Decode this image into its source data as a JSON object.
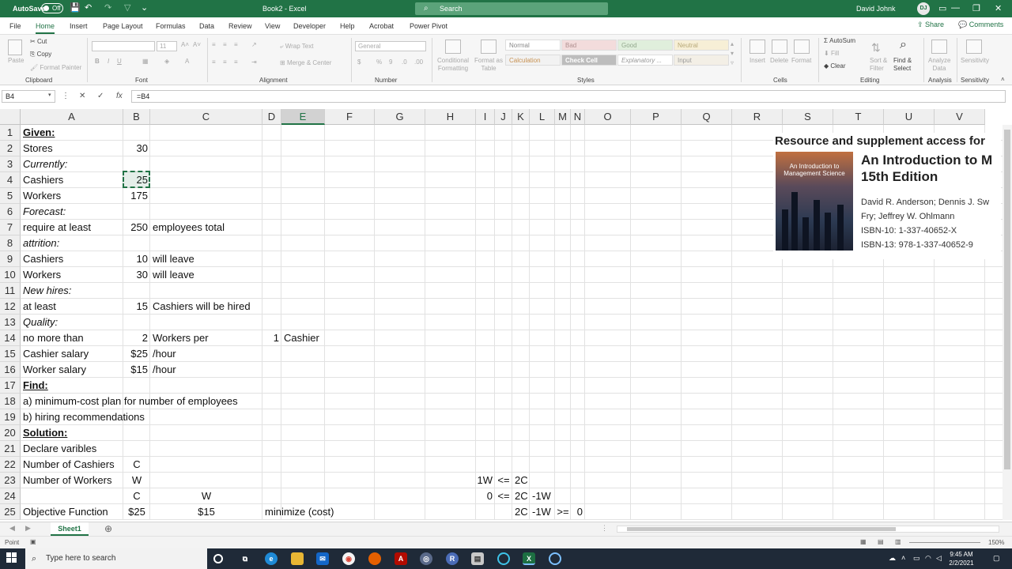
{
  "titlebar": {
    "autosave_label": "AutoSave",
    "autosave_state": "Off",
    "document_title": "Book2 - Excel",
    "search_placeholder": "Search",
    "user_name": "David Johnk",
    "user_initials": "DJ"
  },
  "ribbon_tabs": [
    "File",
    "Home",
    "Insert",
    "Page Layout",
    "Formulas",
    "Data",
    "Review",
    "View",
    "Developer",
    "Help",
    "Acrobat",
    "Power Pivot"
  ],
  "active_tab": "Home",
  "share_label": "Share",
  "comments_label": "Comments",
  "ribbon": {
    "clipboard": {
      "cut": "Cut",
      "copy": "Copy",
      "format_painter": "Format Painter",
      "paste": "Paste",
      "label": "Clipboard"
    },
    "font": {
      "label": "Font",
      "size": "11"
    },
    "alignment": {
      "wrap_text": "Wrap Text",
      "merge_center": "Merge & Center",
      "label": "Alignment"
    },
    "number": {
      "format": "General",
      "label": "Number"
    },
    "styles": {
      "conditional_formatting": "Conditional Formatting",
      "format_as_table": "Format as Table",
      "cells": [
        "Normal",
        "Bad",
        "Good",
        "Neutral",
        "Calculation",
        "Check Cell",
        "Explanatory ...",
        "Input"
      ],
      "label": "Styles"
    },
    "cells": {
      "insert": "Insert",
      "delete": "Delete",
      "format": "Format",
      "label": "Cells"
    },
    "editing": {
      "autosum": "AutoSum",
      "fill": "Fill",
      "clear": "Clear",
      "sort_filter": "Sort & Filter",
      "find_select": "Find & Select",
      "label": "Editing"
    },
    "analysis": {
      "analyze_data": "Analyze Data",
      "label": "Analysis"
    },
    "sensitivity": {
      "label": "Sensitivity"
    }
  },
  "formula_bar": {
    "name_box": "B4",
    "formula": "=B4"
  },
  "columns": [
    "A",
    "B",
    "C",
    "D",
    "E",
    "F",
    "G",
    "H",
    "I",
    "J",
    "K",
    "L",
    "M",
    "N",
    "O",
    "P",
    "Q",
    "R",
    "S",
    "T",
    "U",
    "V"
  ],
  "selected_column": "E",
  "rows": [
    "1",
    "2",
    "3",
    "4",
    "5",
    "6",
    "7",
    "8",
    "9",
    "10",
    "11",
    "12",
    "13",
    "14",
    "15",
    "16",
    "17",
    "18",
    "19",
    "20",
    "21",
    "22",
    "23",
    "24",
    "25"
  ],
  "cells": {
    "A1": "Given:",
    "A2": "Stores",
    "B2": "30",
    "A3": "Currently:",
    "A4": "Cashiers",
    "B4": "25",
    "A5": "Workers",
    "B5": "175",
    "A6": "Forecast:",
    "A7": "require at least",
    "B7": "250",
    "C7": "employees total",
    "A8": "attrition:",
    "A9": "Cashiers",
    "B9": "10",
    "C9": "will leave",
    "A10": "Workers",
    "B10": "30",
    "C10": "will leave",
    "A11": "New hires:",
    "A12": "at least",
    "B12": "15",
    "C12": "Cashiers will be hired",
    "A13": "Quality:",
    "A14": "no more than",
    "B14": "2",
    "C14": "Workers per",
    "D14": "1",
    "E14": "Cashier",
    "A15": "Cashier salary",
    "B15": "$25",
    "C15": "/hour",
    "A16": "Worker salary",
    "B16": "$15",
    "C16": "/hour",
    "A17": "Find:",
    "A18": "a) minimum-cost plan for number of employees",
    "A19": "b) hiring recommendations",
    "A20": "Solution:",
    "A21": "Declare varibles",
    "A22": "Number of Cashiers",
    "B22": "C",
    "A23": "Number of Workers",
    "B23": "W",
    "I23": "1W",
    "J23": "<=",
    "K23": "2C",
    "B24": "C",
    "C24": "W",
    "I24": "0",
    "J24": "<=",
    "K24": "2C",
    "L24": "-1W",
    "A25": "Objective Function",
    "B25": "$25",
    "C25": "$15",
    "D25": "minimize (cost)",
    "K25": "2C",
    "L25": "-1W",
    "M25": ">=",
    "N25": "0"
  },
  "book": {
    "header": "Resource and supplement access for",
    "cover_text": "An Introduction to Management Science",
    "title_line1": "An Introduction to M",
    "title_line2": "15th Edition",
    "authors_line1": "David R. Anderson; Dennis J. Sw",
    "authors_line2": "Fry; Jeffrey W. Ohlmann",
    "isbn10": "ISBN-10: 1-337-40652-X",
    "isbn13": "ISBN-13: 978-1-337-40652-9"
  },
  "sheet_tab": "Sheet1",
  "status": {
    "mode": "Point",
    "zoom": "150%"
  },
  "taskbar": {
    "search_placeholder": "Type here to search",
    "time": "9:45 AM",
    "date": "2/2/2021"
  }
}
